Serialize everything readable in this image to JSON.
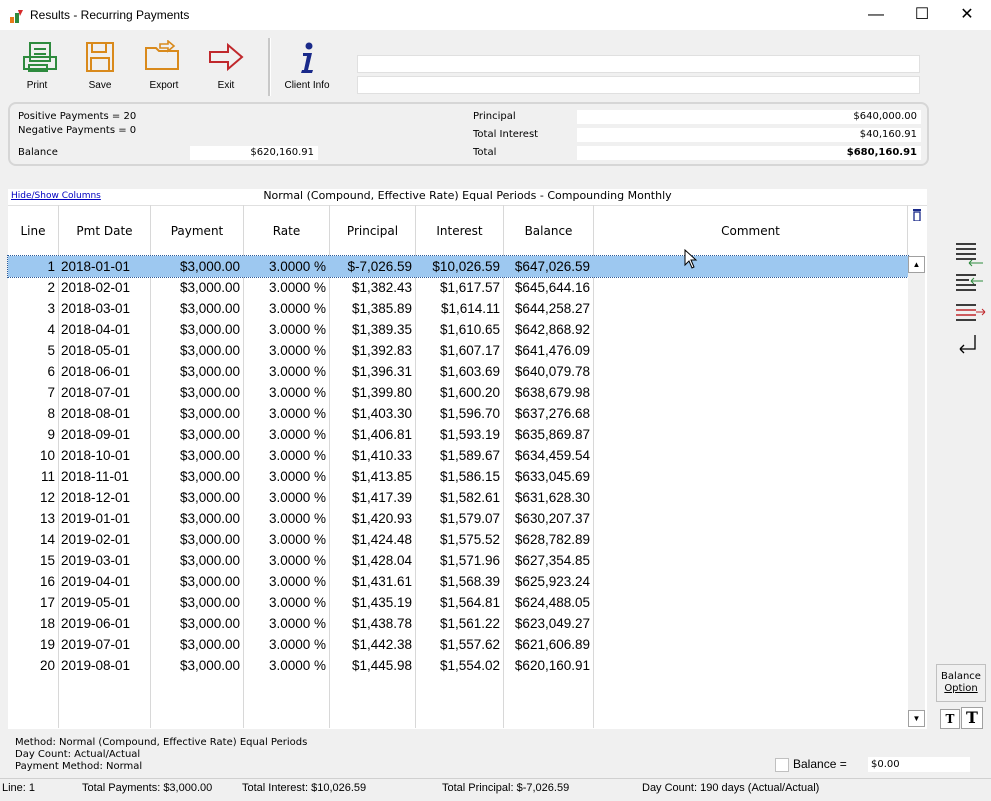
{
  "window": {
    "title": "Results - Recurring Payments",
    "minimize": "—",
    "maximize": "☐",
    "close": "✕"
  },
  "toolbar": {
    "print": "Print",
    "save": "Save",
    "export": "Export",
    "exit": "Exit",
    "client_info": "Client Info",
    "client_line1": "",
    "client_line2": ""
  },
  "summary": {
    "positive_payments": "Positive Payments = 20",
    "negative_payments": "Negative Payments = 0",
    "balance_label": "Balance",
    "balance_value": "$620,160.91",
    "principal_label": "Principal",
    "principal_value": "$640,000.00",
    "total_interest_label": "Total Interest",
    "total_interest_value": "$40,160.91",
    "total_label": "Total",
    "total_value": "$680,160.91"
  },
  "grid": {
    "hide_show": "Hide/Show Columns",
    "title": "Normal (Compound, Effective Rate) Equal Periods - Compounding Monthly",
    "columns": [
      "Line",
      "Pmt Date",
      "Payment",
      "Rate",
      "Principal",
      "Interest",
      "Balance",
      "Comment"
    ],
    "rows": [
      [
        "1",
        "2018-01-01",
        "$3,000.00",
        "3.0000 %",
        "$-7,026.59",
        "$10,026.59",
        "$647,026.59",
        ""
      ],
      [
        "2",
        "2018-02-01",
        "$3,000.00",
        "3.0000 %",
        "$1,382.43",
        "$1,617.57",
        "$645,644.16",
        ""
      ],
      [
        "3",
        "2018-03-01",
        "$3,000.00",
        "3.0000 %",
        "$1,385.89",
        "$1,614.11",
        "$644,258.27",
        ""
      ],
      [
        "4",
        "2018-04-01",
        "$3,000.00",
        "3.0000 %",
        "$1,389.35",
        "$1,610.65",
        "$642,868.92",
        ""
      ],
      [
        "5",
        "2018-05-01",
        "$3,000.00",
        "3.0000 %",
        "$1,392.83",
        "$1,607.17",
        "$641,476.09",
        ""
      ],
      [
        "6",
        "2018-06-01",
        "$3,000.00",
        "3.0000 %",
        "$1,396.31",
        "$1,603.69",
        "$640,079.78",
        ""
      ],
      [
        "7",
        "2018-07-01",
        "$3,000.00",
        "3.0000 %",
        "$1,399.80",
        "$1,600.20",
        "$638,679.98",
        ""
      ],
      [
        "8",
        "2018-08-01",
        "$3,000.00",
        "3.0000 %",
        "$1,403.30",
        "$1,596.70",
        "$637,276.68",
        ""
      ],
      [
        "9",
        "2018-09-01",
        "$3,000.00",
        "3.0000 %",
        "$1,406.81",
        "$1,593.19",
        "$635,869.87",
        ""
      ],
      [
        "10",
        "2018-10-01",
        "$3,000.00",
        "3.0000 %",
        "$1,410.33",
        "$1,589.67",
        "$634,459.54",
        ""
      ],
      [
        "11",
        "2018-11-01",
        "$3,000.00",
        "3.0000 %",
        "$1,413.85",
        "$1,586.15",
        "$633,045.69",
        ""
      ],
      [
        "12",
        "2018-12-01",
        "$3,000.00",
        "3.0000 %",
        "$1,417.39",
        "$1,582.61",
        "$631,628.30",
        ""
      ],
      [
        "13",
        "2019-01-01",
        "$3,000.00",
        "3.0000 %",
        "$1,420.93",
        "$1,579.07",
        "$630,207.37",
        ""
      ],
      [
        "14",
        "2019-02-01",
        "$3,000.00",
        "3.0000 %",
        "$1,424.48",
        "$1,575.52",
        "$628,782.89",
        ""
      ],
      [
        "15",
        "2019-03-01",
        "$3,000.00",
        "3.0000 %",
        "$1,428.04",
        "$1,571.96",
        "$627,354.85",
        ""
      ],
      [
        "16",
        "2019-04-01",
        "$3,000.00",
        "3.0000 %",
        "$1,431.61",
        "$1,568.39",
        "$625,923.24",
        ""
      ],
      [
        "17",
        "2019-05-01",
        "$3,000.00",
        "3.0000 %",
        "$1,435.19",
        "$1,564.81",
        "$624,488.05",
        ""
      ],
      [
        "18",
        "2019-06-01",
        "$3,000.00",
        "3.0000 %",
        "$1,438.78",
        "$1,561.22",
        "$623,049.27",
        ""
      ],
      [
        "19",
        "2019-07-01",
        "$3,000.00",
        "3.0000 %",
        "$1,442.38",
        "$1,557.62",
        "$621,606.89",
        ""
      ],
      [
        "20",
        "2019-08-01",
        "$3,000.00",
        "3.0000 %",
        "$1,445.98",
        "$1,554.02",
        "$620,160.91",
        ""
      ]
    ],
    "selected_row": 0
  },
  "side": {
    "balance_option_line1": "Balance",
    "balance_option_line2": "Option",
    "t_small": "T",
    "t_large": "T"
  },
  "bottom": {
    "method": "Method: Normal (Compound, Effective Rate) Equal Periods",
    "day_count": "Day Count: Actual/Actual",
    "payment_method": "Payment Method: Normal",
    "balance_eq_label": "Balance =",
    "balance_eq_value": "$0.00"
  },
  "status": {
    "line": "Line: 1",
    "total_payments": "Total Payments: $3,000.00",
    "total_interest": "Total Interest: $10,026.59",
    "total_principal": "Total Principal: $-7,026.59",
    "day_count": "Day Count: 190 days (Actual/Actual)"
  },
  "colors": {
    "selected_row": "#9dc8f0",
    "link": "#0000c0",
    "print_green": "#2e8b3e",
    "save_orange": "#d98a1c",
    "exit_red": "#c0282c",
    "info_blue": "#1a2a8a"
  }
}
